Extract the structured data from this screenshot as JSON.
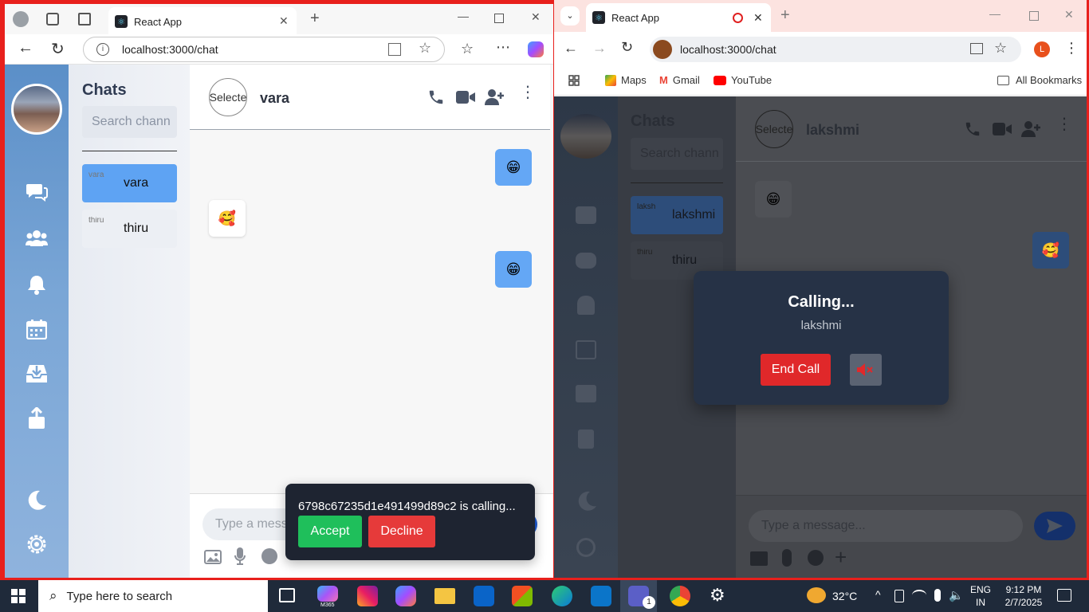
{
  "left_browser": {
    "tab_title": "React App",
    "url": "localhost:3000/chat"
  },
  "right_browser": {
    "tab_title": "React App",
    "url": "localhost:3000/chat",
    "bookmarks": [
      "Maps",
      "Gmail",
      "YouTube"
    ],
    "all_bookmarks": "All Bookmarks",
    "profile_initial": "L"
  },
  "left_app": {
    "sidebar_title": "Chats",
    "search_placeholder": "Search chann",
    "chats": [
      {
        "name": "vara",
        "avatar_alt": "vara",
        "active": true
      },
      {
        "name": "thiru",
        "avatar_alt": "thiru",
        "active": false
      }
    ],
    "header": {
      "avatar_alt": "Selecte",
      "name": "vara"
    },
    "messages": [
      {
        "side": "sent",
        "emoji": "😁"
      },
      {
        "side": "recv",
        "emoji": "🥰"
      },
      {
        "side": "sent",
        "emoji": "😁"
      }
    ],
    "message_placeholder": "Type a messa",
    "incoming_call": {
      "text": "6798c67235d1e491499d89c2 is calling...",
      "accept": "Accept",
      "decline": "Decline"
    }
  },
  "right_app": {
    "sidebar_title": "Chats",
    "search_placeholder": "Search chann",
    "chats": [
      {
        "name": "lakshmi",
        "avatar_alt": "laksh",
        "active": true
      },
      {
        "name": "thiru",
        "avatar_alt": "thiru",
        "active": false
      }
    ],
    "header": {
      "avatar_alt": "Selecte",
      "name": "lakshmi"
    },
    "messages": [
      {
        "side": "recv",
        "emoji": "😁"
      },
      {
        "side": "sent",
        "emoji": "🥰"
      }
    ],
    "message_placeholder": "Type a message...",
    "calling_modal": {
      "title": "Calling...",
      "callee": "lakshmi",
      "end_call": "End Call"
    }
  },
  "taskbar": {
    "search_placeholder": "Type here to search",
    "weather": "32°C",
    "lang_top": "ENG",
    "lang_bottom": "IN",
    "time": "9:12 PM",
    "date": "2/7/2025",
    "teams_badge": "1",
    "m365_label": "M365"
  },
  "colors": {
    "accent_blue": "#64a7f5",
    "accept_green": "#1fbf5b",
    "decline_red": "#e63a3a",
    "end_call_red": "#e0282a"
  }
}
